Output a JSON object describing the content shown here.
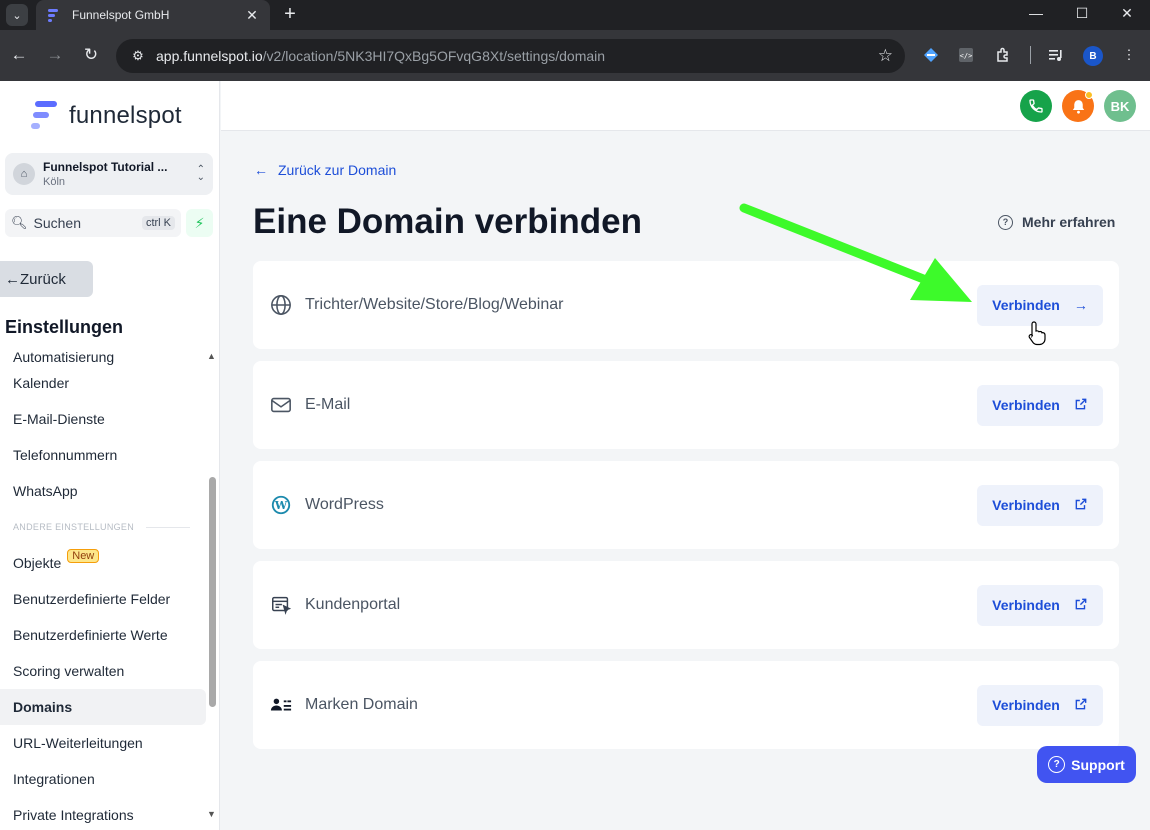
{
  "browser": {
    "tab_title": "Funnelspot GmbH",
    "url_host": "app.funnelspot.io",
    "url_path": "/v2/location/5NK3HI7QxBg5OFvqG8Xt/settings/domain",
    "profile_initial": "B"
  },
  "app": {
    "logo_text": "funnelspot",
    "location": {
      "name": "Funnelspot Tutorial ...",
      "city": "Köln"
    },
    "search_label": "Suchen",
    "search_shortcut": "ctrl K",
    "back_label": "Zurück",
    "settings_title": "Einstellungen",
    "menu": {
      "automation": "Automatisierung",
      "calendar": "Kalender",
      "email_services": "E-Mail-Dienste",
      "phone_numbers": "Telefonnummern",
      "whatsapp": "WhatsApp",
      "section_other": "ANDERE EINSTELLUNGEN",
      "objects": "Objekte",
      "objects_badge": "New",
      "custom_fields": "Benutzerdefinierte Felder",
      "custom_values": "Benutzerdefinierte Werte",
      "scoring": "Scoring verwalten",
      "domains": "Domains",
      "url_redirects": "URL-Weiterleitungen",
      "integrations": "Integrationen",
      "private_integrations": "Private Integrations"
    },
    "user_initials": "BK"
  },
  "main": {
    "back_link": "Zurück zur Domain",
    "title": "Eine Domain verbinden",
    "learn_more": "Mehr erfahren",
    "connect_label": "Verbinden",
    "cards": [
      {
        "label": "Trichter/Website/Store/Blog/Webinar",
        "icon": "globe-icon",
        "action_icon": "arrow-right-icon"
      },
      {
        "label": "E-Mail",
        "icon": "mail-icon",
        "action_icon": "external-link-icon"
      },
      {
        "label": "WordPress",
        "icon": "wordpress-icon",
        "action_icon": "external-link-icon"
      },
      {
        "label": "Kundenportal",
        "icon": "portal-icon",
        "action_icon": "external-link-icon"
      },
      {
        "label": "Marken Domain",
        "icon": "brand-icon",
        "action_icon": "external-link-icon"
      }
    ],
    "support_label": "Support"
  },
  "colors": {
    "accent": "#1d4ed8",
    "support": "#4154f1",
    "phone": "#16a34a",
    "bell": "#f97316",
    "avatar": "#6fbf8e",
    "annotation_arrow": "#3dfa2a"
  }
}
